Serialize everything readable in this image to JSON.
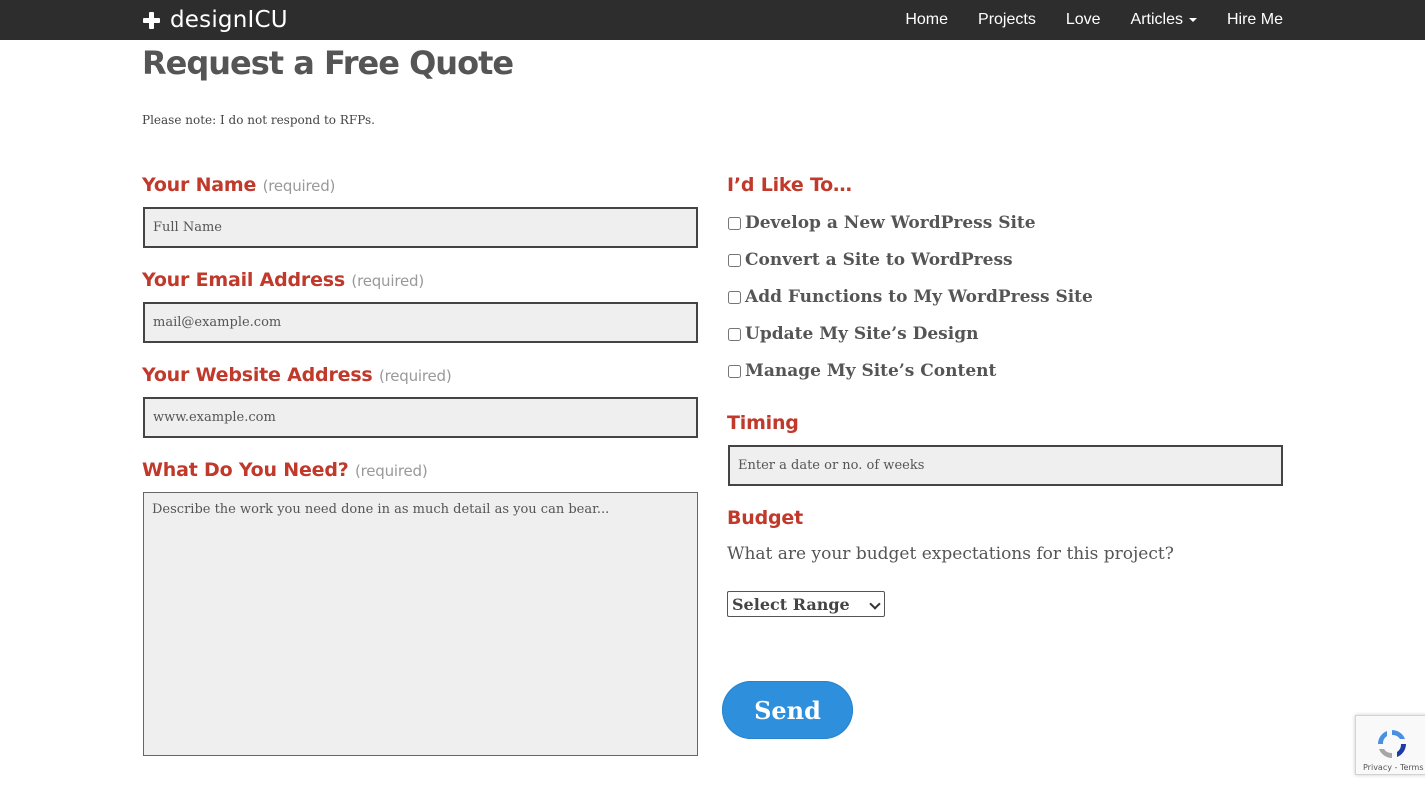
{
  "brand": {
    "name": "designICU",
    "icon": "plus-icon"
  },
  "nav": {
    "items": [
      {
        "label": "Home"
      },
      {
        "label": "Projects"
      },
      {
        "label": "Love"
      },
      {
        "label": "Articles"
      },
      {
        "label": "Hire Me"
      }
    ]
  },
  "page": {
    "title": "Request a Free Quote",
    "note": "Please note: I do not respond to RFPs."
  },
  "form": {
    "name": {
      "label": "Your Name",
      "required": "(required)",
      "placeholder": "Full Name"
    },
    "email": {
      "label": "Your Email Address",
      "required": "(required)",
      "placeholder": "mail@example.com"
    },
    "website": {
      "label": "Your Website Address",
      "required": "(required)",
      "placeholder": "www.example.com"
    },
    "need": {
      "label": "What Do You Need?",
      "required": "(required)",
      "placeholder": "Describe the work you need done in as much detail as you can bear..."
    },
    "like": {
      "label": "I’d Like To…",
      "options": [
        "Develop a New WordPress Site",
        "Convert a Site to WordPress",
        "Add Functions to My WordPress Site",
        "Update My Site’s Design",
        "Manage My Site’s Content"
      ]
    },
    "timing": {
      "label": "Timing",
      "placeholder": "Enter a date or no. of weeks"
    },
    "budget": {
      "label": "Budget",
      "question": "What are your budget expectations for this project?",
      "selected": "Select Range"
    },
    "send_label": "Send"
  },
  "recaptcha": {
    "terms": "Privacy - Terms"
  },
  "colors": {
    "navbar": "#2d2d2d",
    "label_red": "#c0392b",
    "send_blue": "#2e8fdd"
  }
}
